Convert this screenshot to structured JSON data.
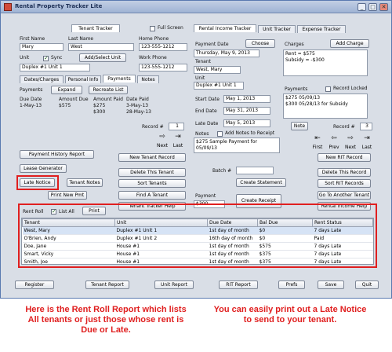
{
  "window": {
    "title": "Rental Property Tracker Lite",
    "minimize": "_",
    "maximize": "□",
    "close": "✕"
  },
  "tenant": {
    "tab_label": "Tenant Tracker",
    "full_screen_label": "Full Screen",
    "first_name_label": "First Name",
    "first_name": "Mary",
    "last_name_label": "Last Name",
    "last_name": "West",
    "home_phone_label": "Home Phone",
    "home_phone": "123-555-1212",
    "unit_label": "Unit",
    "sync_label": "Sync",
    "add_select_unit": "Add/Select Unit",
    "unit_value": "Duplex #1 Unit 1",
    "work_phone_label": "Work Phone",
    "work_phone": "123-555-1212",
    "subtabs": [
      "Dates/Charges",
      "Personal Info",
      "Payments",
      "Notes"
    ],
    "payments_label": "Payments",
    "expand_label": "Expand",
    "recreate_list_label": "Recreate List",
    "pay_headers": [
      "Due Date",
      "Amount Due",
      "Amount Paid",
      "Date Paid"
    ],
    "pay_rows": [
      [
        "1-May-13",
        "$575",
        "$275",
        "3-May-13"
      ],
      [
        "",
        "",
        "$300",
        "28-May-13"
      ]
    ],
    "record_label": "Record #",
    "record_value": "1",
    "next_label": "Next",
    "last_label": "Last",
    "payment_history_btn": "Payment History Report",
    "lease_generator_btn": "Lease Generator",
    "late_notice_btn": "Late Notice",
    "tenant_notes_btn": "Tenant Notes",
    "print_new_pmt_btn": "Print New Pmt",
    "new_tenant_btn": "New Tenant Record",
    "delete_tenant_btn": "Delete This Tenant",
    "sort_tenants_btn": "Sort Tenants",
    "find_tenant_btn": "Find A Tenant",
    "tenant_tracker_help_btn": "Tenant Tracker Help"
  },
  "income": {
    "tabs": [
      "Rental Income Tracker",
      "Unit Tracker",
      "Expense Tracker"
    ],
    "payment_date_label": "Payment Date",
    "choose_label": "Choose",
    "payment_date": "Thursday, May 9, 2013",
    "tenant_label": "Tenant",
    "tenant_value": "West, Mary",
    "unit_label": "Unit",
    "unit_value": "Duplex #1 Unit 1",
    "start_date_label": "Start Date",
    "start_date": "May 1, 2013",
    "end_date_label": "End Date",
    "end_date": "May 31, 2013",
    "late_date_label": "Late Date",
    "late_date": "May 5, 2013",
    "notes_label": "Notes",
    "add_notes_label": "Add Notes to Receipt",
    "notes_value": "$275 Sample Payment for 05/09/13",
    "charges_label": "Charges",
    "add_charge_label": "Add Charge",
    "charges_lines": [
      "Rent = $575",
      "Subsidy = -$300"
    ],
    "payments_label": "Payments",
    "record_locked_label": "Record Locked",
    "payments_lines": [
      "$275 05/09/13",
      "$300 05/28/13 for Subsidy"
    ],
    "note_btn": "Note",
    "record_label": "Record #",
    "record_value": "3",
    "nav_labels": [
      "First",
      "Prev",
      "Next",
      "Last"
    ],
    "batch_label": "Batch #",
    "create_statement_btn": "Create Statement",
    "payment_label": "Payment",
    "payment_value": "$300",
    "create_receipt_btn": "Create Receipt",
    "new_rit_btn": "New RIT Record",
    "delete_record_btn": "Delete This Record",
    "sort_rit_btn": "Sort RIT Records",
    "go_tenant_btn": "Go To Another Tenant",
    "rental_help_btn": "Rental Income Help"
  },
  "rent_roll": {
    "label": "Rent Roll",
    "list_all_label": "List All",
    "print_label": "Print",
    "headers": [
      "Tenant",
      "Unit",
      "Due Date",
      "Bal Due",
      "Rent Status"
    ],
    "rows": [
      [
        "West, Mary",
        "Duplex #1 Unit 1",
        "1st day of month",
        "$0",
        "7 days Late"
      ],
      [
        "O'Brien, Andy",
        "Duplex #1 Unit 2",
        "16th day of month",
        "$0",
        "Paid"
      ],
      [
        "Doe, Jane",
        "House #1",
        "1st day of month",
        "$575",
        "7 days Late"
      ],
      [
        "Smart, Vicky",
        "House #1",
        "1st day of month",
        "$375",
        "7 days Late"
      ],
      [
        "Smith, Joe",
        "House #1",
        "1st day of month",
        "$375",
        "7 days Late"
      ]
    ]
  },
  "bottom_bar": [
    "Register",
    "Tenant Report",
    "Unit Report",
    "RIT Report",
    "Prefs",
    "Save",
    "Quit"
  ],
  "captions": {
    "left": "Here is the Rent Roll Report which lists All tenants or just those whose rent is Due or Late.",
    "right": "You can easily print out a Late Notice to send to your tenant."
  },
  "colors": {
    "accent_red": "#e01f1f",
    "window_bg": "#d9dee6"
  }
}
